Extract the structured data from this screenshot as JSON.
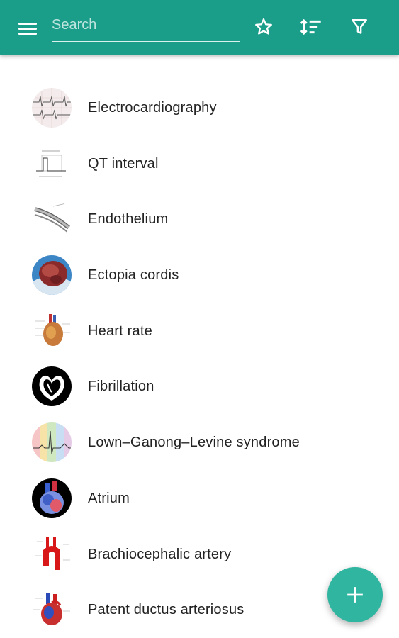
{
  "appbar": {
    "search_placeholder": "Search",
    "icons": [
      "menu-icon",
      "star-icon",
      "sort-icon",
      "filter-icon"
    ]
  },
  "colors": {
    "primary": "#1a9e8a",
    "fab": "#2fb5a0"
  },
  "list": {
    "items": [
      {
        "label": "Electrocardiography",
        "icon": "ecg-thumbnail"
      },
      {
        "label": "QT interval",
        "icon": "qt-diagram-thumbnail"
      },
      {
        "label": "Endothelium",
        "icon": "endothelium-thumbnail"
      },
      {
        "label": "Ectopia cordis",
        "icon": "heart-photo-thumbnail"
      },
      {
        "label": "Heart rate",
        "icon": "heart-anatomy-thumbnail"
      },
      {
        "label": "Fibrillation",
        "icon": "heart-outline-thumbnail"
      },
      {
        "label": "Lown–Ganong–Levine syndrome",
        "icon": "ecg-wave-thumbnail"
      },
      {
        "label": "Atrium",
        "icon": "heart-diagram-thumbnail"
      },
      {
        "label": "Brachiocephalic artery",
        "icon": "artery-thumbnail"
      },
      {
        "label": "Patent ductus arteriosus",
        "icon": "heart-vessels-thumbnail"
      }
    ]
  },
  "fab": {
    "icon": "plus-icon"
  }
}
